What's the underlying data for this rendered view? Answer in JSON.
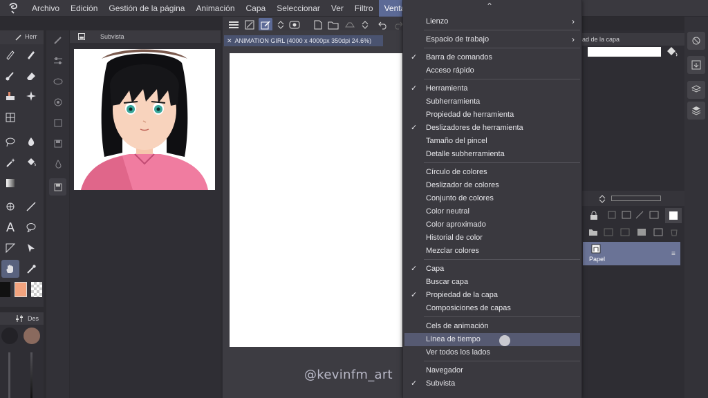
{
  "menu": {
    "items": [
      "Archivo",
      "Edición",
      "Gestión de la página",
      "Animación",
      "Capa",
      "Seleccionar",
      "Ver",
      "Filtro",
      "Ventana"
    ],
    "active": "Ventana"
  },
  "panels": {
    "tool_header": "Herr",
    "subvista_title": "Subvista",
    "sub_header": "Des",
    "layer_prop_title": "ad de la capa"
  },
  "document": {
    "tab_label": "ANIMATION GIRL (4000 x 4000px 350dpi 24.6%)"
  },
  "layers": {
    "items": [
      {
        "name": "Papel"
      }
    ]
  },
  "watermark": "@kevinfm_art",
  "dropdown": {
    "items": [
      {
        "label": "Lienzo",
        "checked": false,
        "submenu": true
      },
      {
        "label": "Espacio de trabajo",
        "checked": false,
        "submenu": true
      },
      {
        "label": "Barra de comandos",
        "checked": true
      },
      {
        "label": "Acceso rápido",
        "checked": false
      },
      {
        "label": "Herramienta",
        "checked": true
      },
      {
        "label": "Subherramienta",
        "checked": false
      },
      {
        "label": "Propiedad de herramienta",
        "checked": false
      },
      {
        "label": "Deslizadores de herramienta",
        "checked": true
      },
      {
        "label": "Tamaño del pincel",
        "checked": false
      },
      {
        "label": "Detalle subherramienta",
        "checked": false
      },
      {
        "label": "Círculo de colores",
        "checked": false
      },
      {
        "label": "Deslizador de colores",
        "checked": false
      },
      {
        "label": "Conjunto de colores",
        "checked": false
      },
      {
        "label": "Color neutral",
        "checked": false
      },
      {
        "label": "Color aproximado",
        "checked": false
      },
      {
        "label": "Historial de color",
        "checked": false
      },
      {
        "label": "Mezclar colores",
        "checked": false
      },
      {
        "label": "Capa",
        "checked": true
      },
      {
        "label": "Buscar capa",
        "checked": false
      },
      {
        "label": "Propiedad de la capa",
        "checked": true
      },
      {
        "label": "Composiciones de capas",
        "checked": false
      },
      {
        "label": "Cels de animación",
        "checked": false
      },
      {
        "label": "Línea de tiempo",
        "checked": false,
        "highlighted": true
      },
      {
        "label": "Ver todos los lados",
        "checked": false
      },
      {
        "label": "Navegador",
        "checked": false
      },
      {
        "label": "Subvista",
        "checked": true
      }
    ],
    "check_glyph": "✓",
    "submenu_glyph": "›",
    "scroll_up_glyph": "⌃"
  },
  "colors": {
    "accent": "#5c6a96",
    "main_color": "#f2a37e",
    "sub_color": "#111111",
    "layer_selected": "#6a7396"
  }
}
